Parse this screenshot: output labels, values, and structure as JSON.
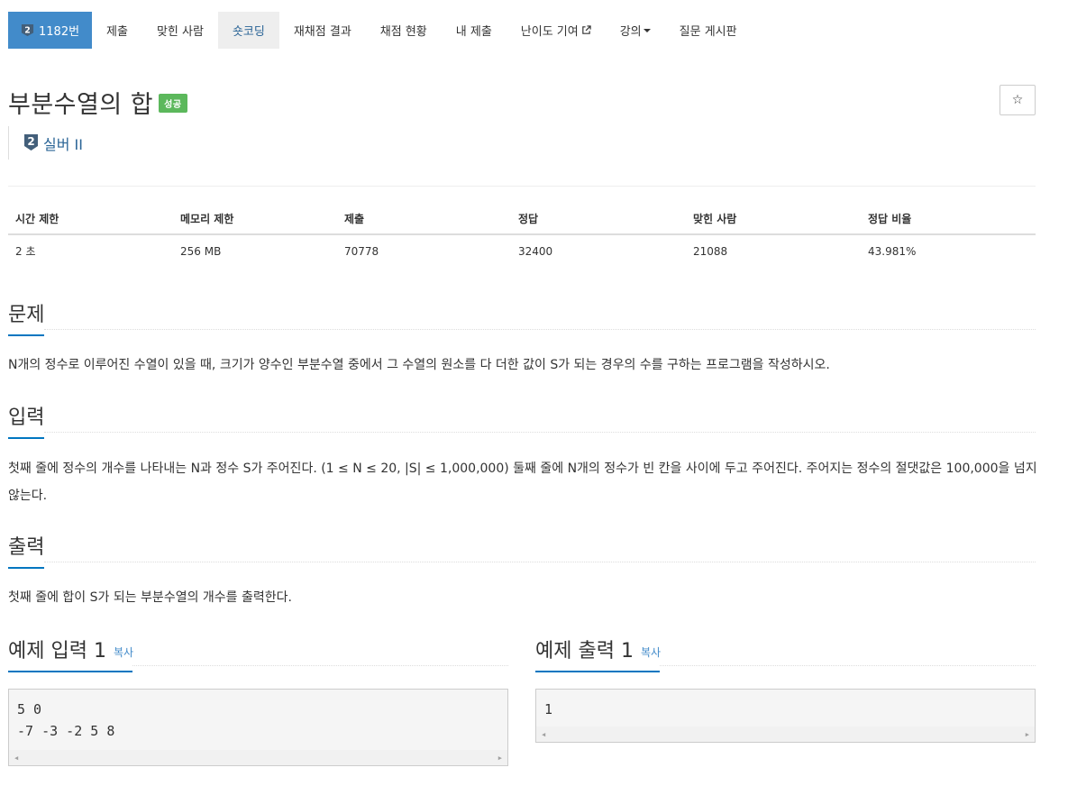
{
  "nav": {
    "problem_number": "1182번",
    "tier_digit": "2",
    "items": [
      "제출",
      "맞힌 사람",
      "숏코딩",
      "재채점 결과",
      "채점 현황",
      "내 제출",
      "난이도 기여",
      "강의",
      "질문 게시판"
    ]
  },
  "problem": {
    "title": "부분수열의 합",
    "result_label": "성공",
    "star": "☆",
    "tier": "실버 II"
  },
  "info": {
    "headers": [
      "시간 제한",
      "메모리 제한",
      "제출",
      "정답",
      "맞힌 사람",
      "정답 비율"
    ],
    "values": [
      "2 초",
      "256 MB",
      "70778",
      "32400",
      "21088",
      "43.981%"
    ]
  },
  "sections": {
    "description_title": "문제",
    "description": "N개의 정수로 이루어진 수열이 있을 때, 크기가 양수인 부분수열 중에서 그 수열의 원소를 다 더한 값이 S가 되는 경우의 수를 구하는 프로그램을 작성하시오.",
    "input_title": "입력",
    "input": "첫째 줄에 정수의 개수를 나타내는 N과 정수 S가 주어진다. (1 ≤ N ≤ 20, |S| ≤ 1,000,000) 둘째 줄에 N개의 정수가 빈 칸을 사이에 두고 주어진다. 주어지는 정수의 절댓값은 100,000을 넘지 않는다.",
    "output_title": "출력",
    "output": "첫째 줄에 합이 S가 되는 부분수열의 개수를 출력한다."
  },
  "samples": {
    "input_title": "예제 입력 1",
    "output_title": "예제 출력 1",
    "copy_label": "복사",
    "input_text": "5 0\n-7 -3 -2 5 8",
    "output_text": "1"
  },
  "colors": {
    "primary": "#428bca",
    "success": "#5cb85c",
    "heading_underline": "#0076c0",
    "tier_silver": "#435f7a"
  }
}
